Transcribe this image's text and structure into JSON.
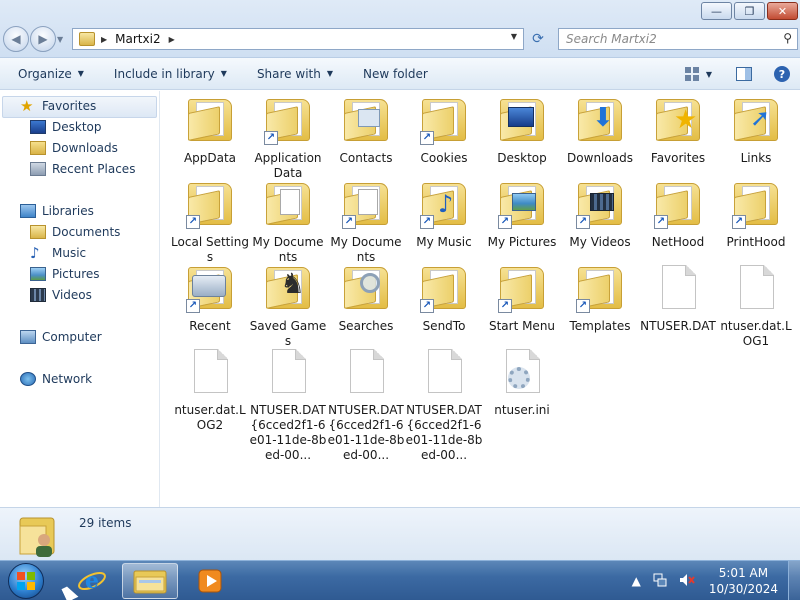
{
  "window": {
    "controls": {
      "minimize": "—",
      "maximize": "❐",
      "close": "✕"
    }
  },
  "address": {
    "crumbs": [
      "Martxi2"
    ],
    "search_placeholder": "Search Martxi2"
  },
  "toolbar": {
    "organize": "Organize",
    "include_in_library": "Include in library",
    "share_with": "Share with",
    "new_folder": "New folder"
  },
  "nav": {
    "favorites": "Favorites",
    "desktop": "Desktop",
    "downloads": "Downloads",
    "recent_places": "Recent Places",
    "libraries": "Libraries",
    "documents": "Documents",
    "music": "Music",
    "pictures": "Pictures",
    "videos": "Videos",
    "computer": "Computer",
    "network": "Network"
  },
  "items": [
    {
      "label": "AppData",
      "icon": "folder",
      "shortcut": false
    },
    {
      "label": "Application Data",
      "icon": "folder",
      "shortcut": true
    },
    {
      "label": "Contacts",
      "icon": "contacts-folder",
      "shortcut": false
    },
    {
      "label": "Cookies",
      "icon": "folder",
      "shortcut": true
    },
    {
      "label": "Desktop",
      "icon": "desktop-folder",
      "shortcut": false
    },
    {
      "label": "Downloads",
      "icon": "downloads-folder",
      "shortcut": false
    },
    {
      "label": "Favorites",
      "icon": "favorites-folder",
      "shortcut": false
    },
    {
      "label": "Links",
      "icon": "links-folder",
      "shortcut": false
    },
    {
      "label": "Local Settings",
      "icon": "folder",
      "shortcut": true
    },
    {
      "label": "My Documents",
      "icon": "documents-folder",
      "shortcut": false
    },
    {
      "label": "My Documents",
      "icon": "documents-folder",
      "shortcut": true
    },
    {
      "label": "My Music",
      "icon": "music-folder",
      "shortcut": true
    },
    {
      "label": "My Pictures",
      "icon": "pictures-folder",
      "shortcut": true
    },
    {
      "label": "My Videos",
      "icon": "videos-folder",
      "shortcut": true
    },
    {
      "label": "NetHood",
      "icon": "folder",
      "shortcut": true
    },
    {
      "label": "PrintHood",
      "icon": "folder",
      "shortcut": true
    },
    {
      "label": "Recent",
      "icon": "recent-folder",
      "shortcut": true
    },
    {
      "label": "Saved Games",
      "icon": "saved-games-folder",
      "shortcut": false
    },
    {
      "label": "Searches",
      "icon": "searches-folder",
      "shortcut": false
    },
    {
      "label": "SendTo",
      "icon": "folder",
      "shortcut": true
    },
    {
      "label": "Start Menu",
      "icon": "folder",
      "shortcut": true
    },
    {
      "label": "Templates",
      "icon": "folder",
      "shortcut": true
    },
    {
      "label": "NTUSER.DAT",
      "icon": "file",
      "shortcut": false
    },
    {
      "label": "ntuser.dat.LOG1",
      "icon": "file",
      "shortcut": false
    },
    {
      "label": "ntuser.dat.LOG2",
      "icon": "file",
      "shortcut": false
    },
    {
      "label": "NTUSER.DAT{6cced2f1-6e01-11de-8bed-00...",
      "icon": "file",
      "shortcut": false
    },
    {
      "label": "NTUSER.DAT{6cced2f1-6e01-11de-8bed-00...",
      "icon": "file",
      "shortcut": false
    },
    {
      "label": "NTUSER.DAT{6cced2f1-6e01-11de-8bed-00...",
      "icon": "file",
      "shortcut": false
    },
    {
      "label": "ntuser.ini",
      "icon": "settings-file",
      "shortcut": false
    }
  ],
  "details": {
    "item_count": "29 items"
  },
  "taskbar": {
    "time": "5:01 AM",
    "date": "10/30/2024",
    "tray_expand": "▲"
  }
}
